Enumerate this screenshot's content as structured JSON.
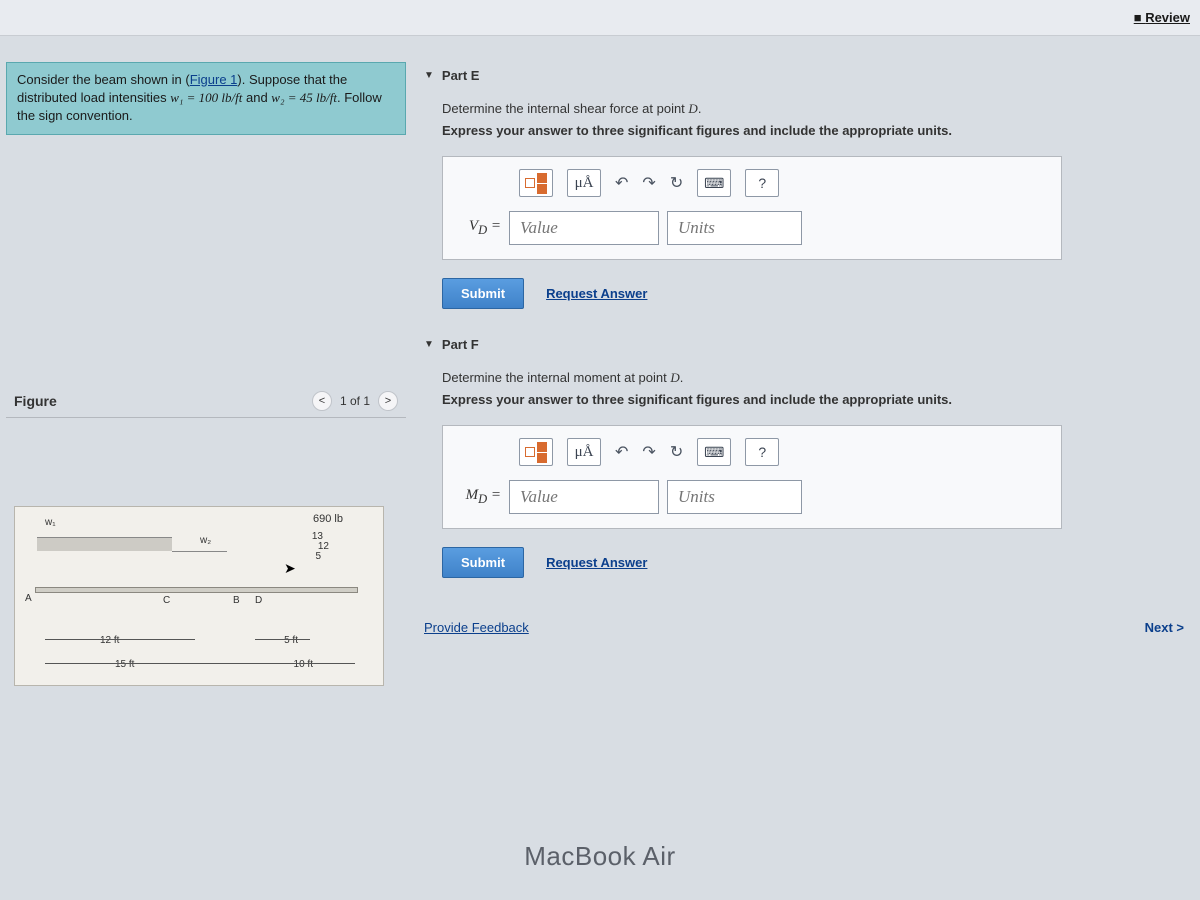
{
  "header": {
    "review_label": "Review"
  },
  "problem": {
    "text_before_link": "Consider the beam shown in (",
    "figure_link": "Figure 1",
    "text_after_link": "). Suppose that the distributed load intensities ",
    "w1_eq": "w₁ = 100 lb/ft",
    "connector": " and ",
    "w2_eq": "w₂ = 45 lb/ft",
    "trailer": ". Follow the sign convention."
  },
  "figure_panel": {
    "title": "Figure",
    "pager": "1 of 1",
    "load_label": "690 lb",
    "angle_top": "13",
    "angle_bot": "12",
    "angle_side": "5",
    "w1": "w₁",
    "w2": "w₂",
    "ptA": "A",
    "ptB": "B",
    "ptC": "C",
    "ptD": "D",
    "dim_12": "12 ft",
    "dim_15": "15 ft",
    "dim_5": "5 ft",
    "dim_10": "10 ft"
  },
  "parts": {
    "E": {
      "title": "Part E",
      "instr1": "Determine the internal shear force at point D.",
      "instr2": "Express your answer to three significant figures and include the appropriate units.",
      "var": "V_D =",
      "value_ph": "Value",
      "units_ph": "Units",
      "submit": "Submit",
      "request": "Request Answer",
      "units_tool": "μÅ",
      "help": "?"
    },
    "F": {
      "title": "Part F",
      "instr1": "Determine the internal moment at point D.",
      "instr2": "Express your answer to three significant figures and include the appropriate units.",
      "var": "M_D =",
      "value_ph": "Value",
      "units_ph": "Units",
      "submit": "Submit",
      "request": "Request Answer",
      "units_tool": "μÅ",
      "help": "?"
    }
  },
  "footer": {
    "feedback": "Provide Feedback",
    "next": "Next >"
  },
  "laptop": "MacBook Air"
}
